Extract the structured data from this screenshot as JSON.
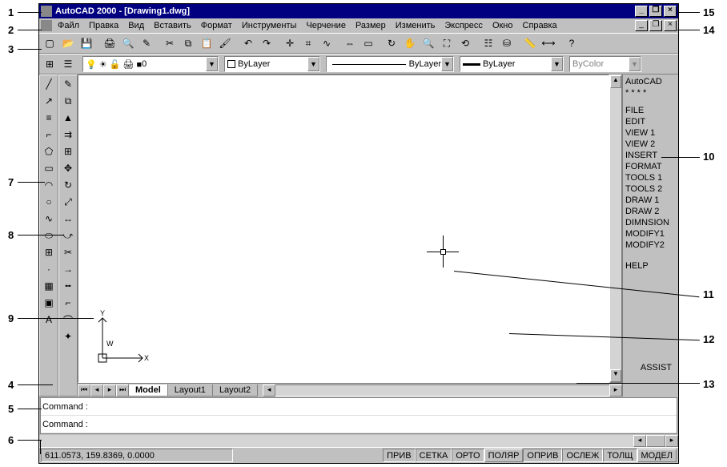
{
  "title": "AutoCAD 2000 - [Drawing1.dwg]",
  "menus": [
    "Файл",
    "Правка",
    "Вид",
    "Вставить",
    "Формат",
    "Инструменты",
    "Черчение",
    "Размер",
    "Изменить",
    "Экспресс",
    "Окно",
    "Справка"
  ],
  "layer_combo": "0",
  "color_combo": "ByLayer",
  "linetype_combo": "ByLayer",
  "lineweight_combo": "ByLayer",
  "plotstyle_combo": "ByColor",
  "tabs": {
    "active": "Model",
    "others": [
      "Layout1",
      "Layout2"
    ]
  },
  "sidemenu": {
    "header": "AutoCAD",
    "stars": "* * * *",
    "items": [
      "FILE",
      "EDIT",
      "VIEW 1",
      "VIEW 2",
      "INSERT",
      "FORMAT",
      "TOOLS 1",
      "TOOLS 2",
      "DRAW 1",
      "DRAW 2",
      "DIMNSION",
      "MODIFY1",
      "MODIFY2"
    ],
    "help": "HELP",
    "assist": "ASSIST"
  },
  "command_prompt": "Command :",
  "coords": "611.0573, 159.8369, 0.0000",
  "status_toggles": [
    "ПРИВ",
    "СЕТКА",
    "ОРТО",
    "ПОЛЯР",
    "ОПРИВ",
    "ОСЛЕЖ",
    "ТОЛЩ",
    "МОДЕЛ"
  ],
  "callouts": {
    "1": "1",
    "2": "2",
    "3": "3",
    "4": "4",
    "5": "5",
    "6": "6",
    "7": "7",
    "8": "8",
    "9": "9",
    "10": "10",
    "11": "11",
    "12": "12",
    "13": "13",
    "14": "14",
    "15": "15"
  }
}
